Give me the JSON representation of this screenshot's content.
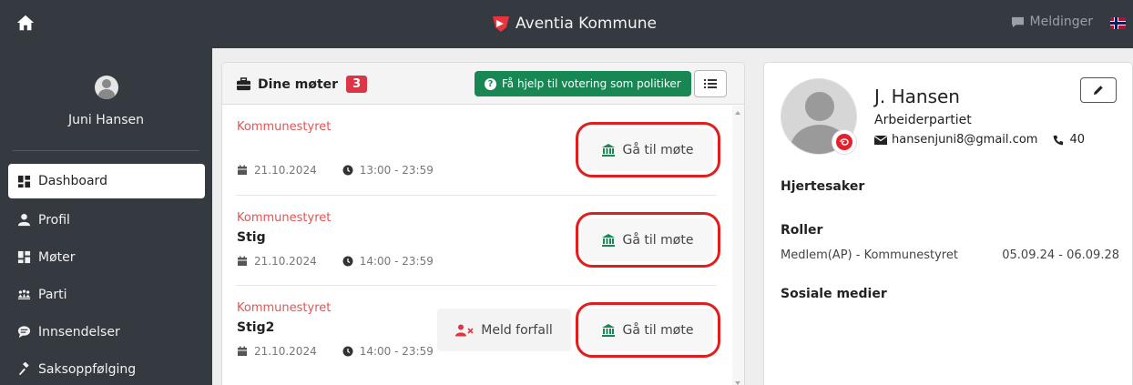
{
  "topbar": {
    "brand": "Aventia Kommune",
    "messages_label": "Meldinger",
    "home_icon": "home-icon",
    "flag": "norwegian-flag-icon"
  },
  "sidebar": {
    "user_name": "Juni Hansen",
    "items": [
      {
        "label": "Dashboard",
        "icon": "dashboard-icon",
        "active": true
      },
      {
        "label": "Profil",
        "icon": "user-icon"
      },
      {
        "label": "Møter",
        "icon": "meetings-icon"
      },
      {
        "label": "Parti",
        "icon": "party-icon"
      },
      {
        "label": "Innsendelser",
        "icon": "comment-icon"
      },
      {
        "label": "Saksoppfølging",
        "icon": "gavel-icon"
      }
    ]
  },
  "meetings": {
    "title": "Dine møter",
    "count": "3",
    "help_button": "Få hjelp til votering som politiker",
    "list": [
      {
        "org": "Kommunestyret",
        "name": "",
        "date": "21.10.2024",
        "time": "13:00 - 23:59",
        "go_label": "Gå til møte"
      },
      {
        "org": "Kommunestyret",
        "name": "Stig",
        "date": "21.10.2024",
        "time": "14:00 - 23:59",
        "go_label": "Gå til møte"
      },
      {
        "org": "Kommunestyret",
        "name": "Stig2",
        "date": "21.10.2024",
        "time": "14:00 - 23:59",
        "go_label": "Gå til møte",
        "forfall_label": "Meld forfall"
      }
    ],
    "highlight_color": "#e01e1e"
  },
  "profile": {
    "name": "J. Hansen",
    "party": "Arbeiderpartiet",
    "email": "hansenjuni8@gmail.com",
    "phone": "40",
    "sections": {
      "hjertesaker": "Hjertesaker",
      "roller": "Roller",
      "sosiale_medier": "Sosiale medier"
    },
    "role": {
      "name": "Medlem(AP) - Kommunestyret",
      "period": "05.09.24 - 06.09.28"
    }
  },
  "colors": {
    "navbar": "#343a40",
    "help_button": "#198754",
    "badge": "#dc3545",
    "org_text": "#e05555",
    "institution_icon": "#198754"
  }
}
